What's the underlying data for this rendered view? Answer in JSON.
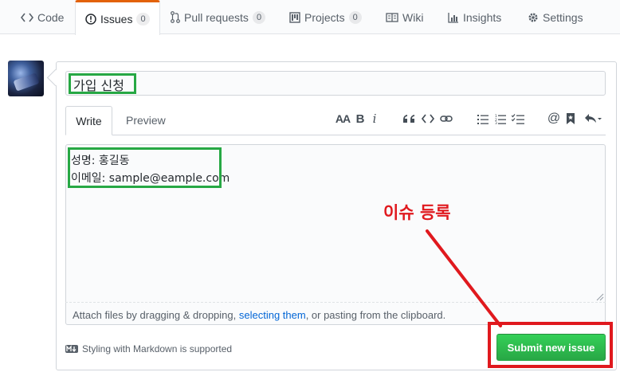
{
  "nav": {
    "tabs": [
      {
        "label": "Code",
        "icon": "code-icon"
      },
      {
        "label": "Issues",
        "icon": "issue-opened-icon",
        "count": "0"
      },
      {
        "label": "Pull requests",
        "icon": "git-pull-request-icon",
        "count": "0"
      },
      {
        "label": "Projects",
        "icon": "project-icon",
        "count": "0"
      },
      {
        "label": "Wiki",
        "icon": "book-icon"
      },
      {
        "label": "Insights",
        "icon": "graph-icon"
      },
      {
        "label": "Settings",
        "icon": "gear-icon"
      }
    ],
    "selected": "Issues"
  },
  "issue_form": {
    "title_value": "가입 신청",
    "tabs": {
      "write": "Write",
      "preview": "Preview"
    },
    "body_lines": [
      "성명: 홍길동",
      "이메일: sample@eample.com"
    ],
    "attach": {
      "prefix": "Attach files by dragging & dropping, ",
      "link": "selecting them",
      "suffix": ", or pasting from the clipboard."
    },
    "markdown_hint": "Styling with Markdown is supported",
    "submit_label": "Submit new issue"
  },
  "toolbar": {
    "icons": [
      "text-size-icon",
      "bold-icon",
      "italic-icon",
      "quote-icon",
      "code-icon",
      "link-icon",
      "unordered-list-icon",
      "ordered-list-icon",
      "task-list-icon",
      "mention-icon",
      "bookmark-icon",
      "reply-icon"
    ],
    "labels": {
      "header": "AA",
      "bold": "B",
      "italic": "i",
      "mention": "@"
    }
  },
  "annotation": {
    "label": "이슈 등록",
    "color": "#e0191e",
    "highlight_color": "#27a844"
  },
  "colors": {
    "accent_tab": "#e36209",
    "submit_green": "#28a745",
    "link": "#0366d6"
  }
}
